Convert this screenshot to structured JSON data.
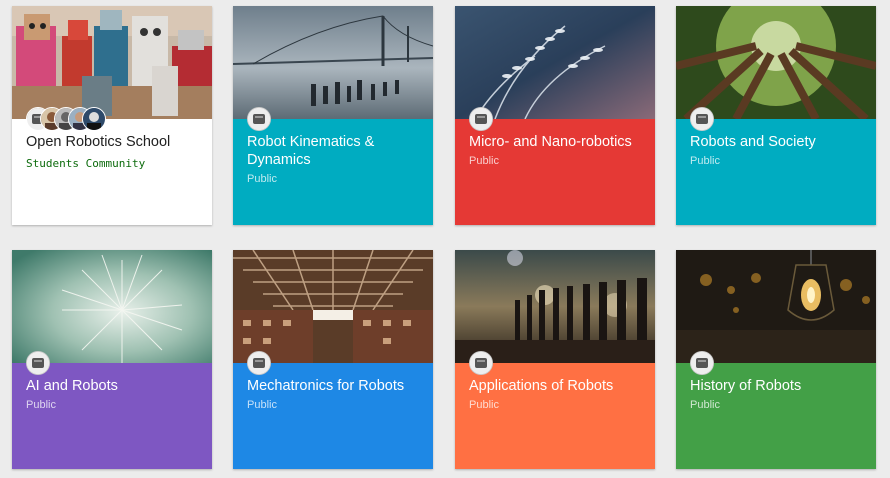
{
  "communities": [
    {
      "title": "Open Robotics School",
      "subtitle": "Students Community",
      "bg": "#ffffff"
    },
    {
      "title": "Robot Kinematics & Dynamics",
      "subtitle": "Public",
      "bg": "#00acc1"
    },
    {
      "title": "Micro- and Nano-robotics",
      "subtitle": "Public",
      "bg": "#e53935"
    },
    {
      "title": "Robots and Society",
      "subtitle": "Public",
      "bg": "#00acc1"
    },
    {
      "title": "AI and Robots",
      "subtitle": "Public",
      "bg": "#7e57c2"
    },
    {
      "title": "Mechatronics for Robots",
      "subtitle": "Public",
      "bg": "#1e88e5"
    },
    {
      "title": "Applications of Robots",
      "subtitle": "Public",
      "bg": "#ff7043"
    },
    {
      "title": "History of Robots",
      "subtitle": "Public",
      "bg": "#43a047"
    }
  ]
}
